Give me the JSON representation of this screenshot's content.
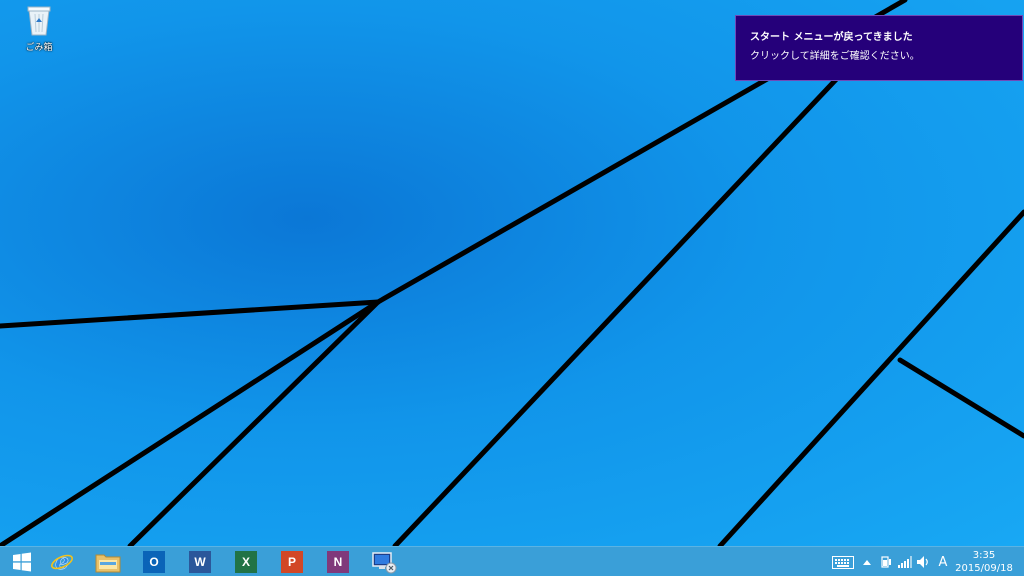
{
  "desktop": {
    "recycle_bin_label": "ごみ箱"
  },
  "toast": {
    "title": "スタート メニューが戻ってきました",
    "message": "クリックして詳細をご確認ください。",
    "background": "#25007a"
  },
  "taskbar": {
    "color": "#3a9fd8",
    "apps": [
      {
        "name": "start",
        "icon": "windows-logo-icon"
      },
      {
        "name": "internet-explorer",
        "icon": "ie-icon",
        "glyph": "e"
      },
      {
        "name": "file-explorer",
        "icon": "folder-icon"
      },
      {
        "name": "outlook",
        "icon": "outlook-icon",
        "glyph": "O",
        "color": "#0a64b8"
      },
      {
        "name": "word",
        "icon": "word-icon",
        "glyph": "W",
        "color": "#2b579a"
      },
      {
        "name": "excel",
        "icon": "excel-icon",
        "glyph": "X",
        "color": "#217346"
      },
      {
        "name": "powerpoint",
        "icon": "powerpoint-icon",
        "glyph": "P",
        "color": "#d24726"
      },
      {
        "name": "onenote",
        "icon": "onenote-icon",
        "glyph": "N",
        "color": "#80397b"
      },
      {
        "name": "remote-desktop",
        "icon": "remote-desktop-icon"
      }
    ],
    "tray": {
      "ime_mode": "A",
      "time": "3:35",
      "date": "2015/09/18"
    }
  }
}
